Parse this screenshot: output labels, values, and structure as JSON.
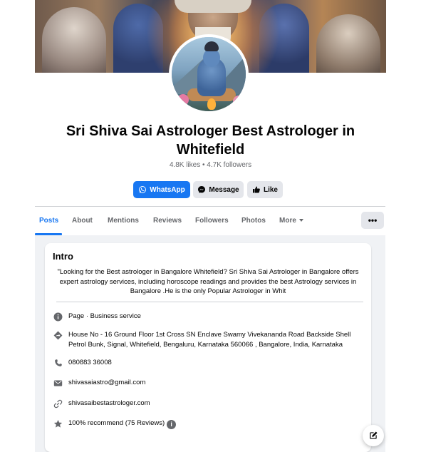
{
  "page": {
    "name": "Sri Shiva Sai Astrologer Best Astrologer in Whitefield",
    "stats": "4.8K likes • 4.7K followers"
  },
  "actions": {
    "whatsapp": "WhatsApp",
    "message": "Message",
    "like": "Like"
  },
  "tabs": [
    {
      "label": "Posts",
      "active": true
    },
    {
      "label": "About",
      "active": false
    },
    {
      "label": "Mentions",
      "active": false
    },
    {
      "label": "Reviews",
      "active": false
    },
    {
      "label": "Followers",
      "active": false
    },
    {
      "label": "Photos",
      "active": false
    },
    {
      "label": "More",
      "active": false
    }
  ],
  "more_menu": "•••",
  "intro": {
    "title": "Intro",
    "text": "\"Looking for the Best astrologer in Bangalore Whitefield? Sri Shiva Sai Astrologer in Bangalore offers expert astrology services, including horoscope readings and provides the best Astrology services in Bangalore .He is the only Popular Astrologer in Whit",
    "category": "Page · Business service",
    "address": "House No - 16 Ground Floor 1st Cross SN Enclave Swamy Vivekananda Road Backside Shell Petrol Bunk, Signal, Whitefield, Bengaluru, Karnataka 560066 , Bangalore, India, Karnataka",
    "phone": "080883 36008",
    "email": "shivasaiastro@gmail.com",
    "website": "shivasaibestastrologer.com",
    "rating": "100% recommend (75 Reviews)"
  },
  "icons": {
    "category": "info-icon",
    "address": "location-diamond-icon",
    "phone": "phone-icon",
    "email": "mail-icon",
    "website": "link-icon",
    "rating": "star-icon",
    "compose": "compose-icon"
  },
  "colors": {
    "accent": "#1877f2",
    "secondary_button": "#e4e6eb",
    "muted_text": "#65676b",
    "feed_background": "#f0f2f5"
  }
}
